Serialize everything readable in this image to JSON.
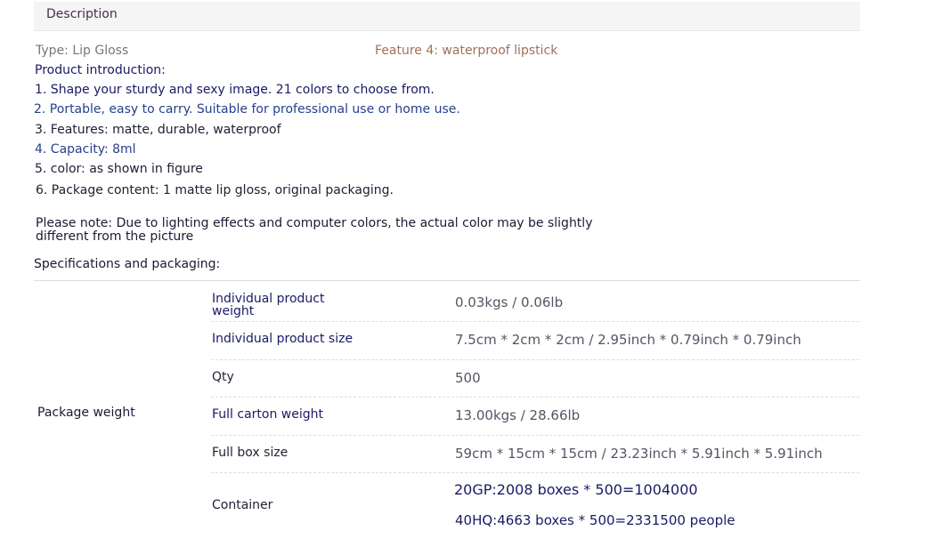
{
  "description_tab": {
    "label": "Description"
  },
  "intro": {
    "type_line": "Type: Lip Gloss",
    "feature_line": "Feature 4: waterproof lipstick",
    "heading": "Product introduction:",
    "items": [
      "1. Shape your sturdy and sexy image. 21 colors to choose from.",
      "2. Portable, easy to carry. Suitable for professional use or home use.",
      "3. Features: matte, durable, waterproof",
      "4. Capacity: 8ml",
      "5. color: as shown in figure",
      "6. Package content: 1 matte lip gloss, original packaging."
    ],
    "note": "Please note: Due to lighting effects and computer colors, the actual color may be slightly different from the picture"
  },
  "specs": {
    "heading": "Specifications and packaging:",
    "group_label": "Package weight",
    "rows": [
      {
        "label": "Individual product weight",
        "value": "0.03kgs / 0.06lb"
      },
      {
        "label": "Individual product size",
        "value": "7.5cm * 2cm * 2cm / 2.95inch * 0.79inch * 0.79inch"
      },
      {
        "label": "Qty",
        "value": "500"
      },
      {
        "label": "Full carton weight",
        "value": "13.00kgs / 28.66lb"
      },
      {
        "label": "Full box size",
        "value": "59cm * 15cm * 15cm / 23.23inch * 5.91inch * 5.91inch"
      },
      {
        "label": "Container",
        "values": [
          "20GP:2008 boxes * 500=1004000",
          "40HQ:4663 boxes * 500=2331500 people"
        ]
      }
    ]
  }
}
